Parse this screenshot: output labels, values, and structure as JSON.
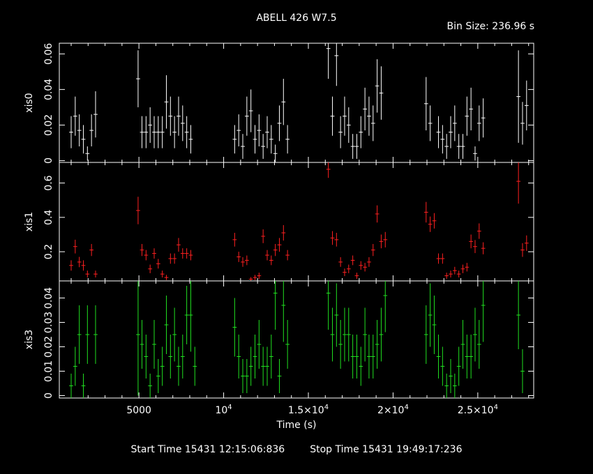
{
  "chart_data": {
    "type": "scatter",
    "title": "ABELL 426 W7.5",
    "bin_size_label": "Bin Size: 236.96 s",
    "xlabel": "Time (s)",
    "xlim": [
      300,
      28300
    ],
    "x_ticks": [
      {
        "value": 5000,
        "label": "5000"
      },
      {
        "value": 10000,
        "label": "10",
        "exp": "4"
      },
      {
        "value": 15000,
        "label": "1.5×10",
        "exp": "4"
      },
      {
        "value": 20000,
        "label": "2×10",
        "exp": "4"
      },
      {
        "value": 25000,
        "label": "2.5×10",
        "exp": "4"
      }
    ],
    "footer": {
      "start": "Start Time 15431 12:15:06:836",
      "stop": "Stop Time 15431 19:49:17:236"
    },
    "xerr": 118.5,
    "panels": [
      {
        "name": "xis0",
        "ylabel": "xis0",
        "color": "#ffffff",
        "ylim": [
          -0.001,
          0.066
        ],
        "y_ticks": [
          0,
          0.02,
          0.04,
          0.06
        ],
        "y_tick_labels": [
          "0",
          "0.02",
          "0.04",
          "0.06"
        ],
        "points": [
          [
            1000,
            0.016,
            0.009
          ],
          [
            1240,
            0.025,
            0.011
          ],
          [
            1480,
            0.017,
            0.009
          ],
          [
            1720,
            0.012,
            0.008
          ],
          [
            1960,
            0.004,
            0.004
          ],
          [
            2200,
            0.017,
            0.009
          ],
          [
            2440,
            0.026,
            0.013
          ],
          [
            4950,
            0.046,
            0.016
          ],
          [
            5180,
            0.016,
            0.009
          ],
          [
            5420,
            0.016,
            0.009
          ],
          [
            5660,
            0.02,
            0.01
          ],
          [
            5900,
            0.016,
            0.009
          ],
          [
            6140,
            0.016,
            0.009
          ],
          [
            6380,
            0.016,
            0.009
          ],
          [
            6620,
            0.033,
            0.015
          ],
          [
            6860,
            0.025,
            0.011
          ],
          [
            7100,
            0.016,
            0.009
          ],
          [
            7340,
            0.025,
            0.011
          ],
          [
            7580,
            0.021,
            0.01
          ],
          [
            7820,
            0.016,
            0.009
          ],
          [
            8060,
            0.012,
            0.008
          ],
          [
            10650,
            0.012,
            0.008
          ],
          [
            10890,
            0.017,
            0.009
          ],
          [
            11130,
            0.008,
            0.007
          ],
          [
            11370,
            0.025,
            0.011
          ],
          [
            11610,
            0.028,
            0.012
          ],
          [
            11850,
            0.012,
            0.008
          ],
          [
            12090,
            0.017,
            0.009
          ],
          [
            12330,
            0.008,
            0.007
          ],
          [
            12570,
            0.016,
            0.009
          ],
          [
            12810,
            0.012,
            0.008
          ],
          [
            13050,
            0.004,
            0.005
          ],
          [
            13290,
            0.021,
            0.01
          ],
          [
            13530,
            0.033,
            0.013
          ],
          [
            13770,
            0.012,
            0.008
          ],
          [
            16180,
            0.063,
            0.017
          ],
          [
            16420,
            0.025,
            0.011
          ],
          [
            16660,
            0.059,
            0.017
          ],
          [
            16900,
            0.016,
            0.009
          ],
          [
            17140,
            0.025,
            0.011
          ],
          [
            17380,
            0.02,
            0.01
          ],
          [
            17620,
            0.008,
            0.007
          ],
          [
            17860,
            0.008,
            0.007
          ],
          [
            18100,
            0.016,
            0.009
          ],
          [
            18340,
            0.029,
            0.012
          ],
          [
            18580,
            0.025,
            0.011
          ],
          [
            18820,
            0.021,
            0.01
          ],
          [
            19060,
            0.042,
            0.015
          ],
          [
            19300,
            0.038,
            0.015
          ],
          [
            21950,
            0.032,
            0.015
          ],
          [
            22190,
            0.021,
            0.01
          ],
          [
            22680,
            0.016,
            0.009
          ],
          [
            22920,
            0.012,
            0.008
          ],
          [
            23160,
            0.008,
            0.007
          ],
          [
            23400,
            0.016,
            0.009
          ],
          [
            23640,
            0.021,
            0.01
          ],
          [
            23880,
            0.008,
            0.007
          ],
          [
            24120,
            0.008,
            0.007
          ],
          [
            24360,
            0.025,
            0.011
          ],
          [
            24600,
            0.029,
            0.012
          ],
          [
            24840,
            0.004,
            0.004
          ],
          [
            25080,
            0.021,
            0.01
          ],
          [
            25320,
            0.024,
            0.011
          ],
          [
            27400,
            0.036,
            0.026
          ],
          [
            27640,
            0.021,
            0.012
          ],
          [
            27880,
            0.031,
            0.014
          ]
        ]
      },
      {
        "name": "xis1",
        "ylabel": "xis1",
        "color": "#ff2020",
        "ylim": [
          0.03,
          0.72
        ],
        "y_ticks": [
          0.2,
          0.4,
          0.6
        ],
        "y_tick_labels": [
          "0.2",
          "0.4",
          "0.6"
        ],
        "points": [
          [
            1000,
            0.12,
            0.03
          ],
          [
            1240,
            0.23,
            0.04
          ],
          [
            1480,
            0.14,
            0.03
          ],
          [
            1720,
            0.12,
            0.03
          ],
          [
            1960,
            0.07,
            0.02
          ],
          [
            2200,
            0.21,
            0.035
          ],
          [
            2440,
            0.07,
            0.02
          ],
          [
            4950,
            0.44,
            0.08
          ],
          [
            5180,
            0.21,
            0.035
          ],
          [
            5420,
            0.18,
            0.03
          ],
          [
            5660,
            0.1,
            0.025
          ],
          [
            5900,
            0.19,
            0.03
          ],
          [
            6140,
            0.13,
            0.028
          ],
          [
            6380,
            0.07,
            0.02
          ],
          [
            6620,
            0.05,
            0.015
          ],
          [
            6860,
            0.16,
            0.03
          ],
          [
            7100,
            0.16,
            0.03
          ],
          [
            7340,
            0.24,
            0.04
          ],
          [
            7580,
            0.19,
            0.03
          ],
          [
            7820,
            0.19,
            0.03
          ],
          [
            8060,
            0.18,
            0.03
          ],
          [
            10650,
            0.27,
            0.04
          ],
          [
            10890,
            0.17,
            0.03
          ],
          [
            11130,
            0.14,
            0.028
          ],
          [
            11370,
            0.15,
            0.028
          ],
          [
            11610,
            0.04,
            0.012
          ],
          [
            11850,
            0.05,
            0.015
          ],
          [
            12090,
            0.06,
            0.018
          ],
          [
            12330,
            0.29,
            0.04
          ],
          [
            12570,
            0.18,
            0.03
          ],
          [
            12810,
            0.15,
            0.028
          ],
          [
            13050,
            0.21,
            0.035
          ],
          [
            13290,
            0.24,
            0.04
          ],
          [
            13530,
            0.31,
            0.045
          ],
          [
            13770,
            0.18,
            0.03
          ],
          [
            16180,
            0.68,
            0.05
          ],
          [
            16420,
            0.28,
            0.04
          ],
          [
            16660,
            0.27,
            0.04
          ],
          [
            16900,
            0.14,
            0.028
          ],
          [
            17140,
            0.08,
            0.022
          ],
          [
            17380,
            0.1,
            0.025
          ],
          [
            17620,
            0.15,
            0.028
          ],
          [
            17860,
            0.06,
            0.018
          ],
          [
            18100,
            0.12,
            0.025
          ],
          [
            18340,
            0.11,
            0.025
          ],
          [
            18580,
            0.14,
            0.028
          ],
          [
            18820,
            0.21,
            0.035
          ],
          [
            19060,
            0.42,
            0.05
          ],
          [
            19300,
            0.26,
            0.04
          ],
          [
            19540,
            0.27,
            0.045
          ],
          [
            21950,
            0.43,
            0.06
          ],
          [
            22190,
            0.36,
            0.045
          ],
          [
            22430,
            0.38,
            0.045
          ],
          [
            22680,
            0.16,
            0.03
          ],
          [
            22920,
            0.16,
            0.03
          ],
          [
            23160,
            0.06,
            0.018
          ],
          [
            23400,
            0.07,
            0.02
          ],
          [
            23640,
            0.09,
            0.022
          ],
          [
            23880,
            0.07,
            0.02
          ],
          [
            24120,
            0.1,
            0.025
          ],
          [
            24360,
            0.11,
            0.025
          ],
          [
            24600,
            0.26,
            0.04
          ],
          [
            24840,
            0.23,
            0.038
          ],
          [
            25080,
            0.32,
            0.045
          ],
          [
            25320,
            0.22,
            0.035
          ],
          [
            27400,
            0.61,
            0.13
          ],
          [
            27640,
            0.21,
            0.04
          ],
          [
            27880,
            0.25,
            0.045
          ]
        ]
      },
      {
        "name": "xis3",
        "ylabel": "xis3",
        "color": "#20e020",
        "ylim": [
          -0.001,
          0.047
        ],
        "y_ticks": [
          0,
          0.01,
          0.02,
          0.03,
          0.04
        ],
        "y_tick_labels": [
          "0",
          "0.01",
          "0.02",
          "0.03",
          "0.04"
        ],
        "points": [
          [
            1000,
            0.004,
            0.005
          ],
          [
            1240,
            0.012,
            0.008
          ],
          [
            1480,
            0.025,
            0.012
          ],
          [
            1720,
            0.004,
            0.005
          ],
          [
            1960,
            0.025,
            0.012
          ],
          [
            2440,
            0.025,
            0.012
          ],
          [
            4950,
            0.025,
            0.025
          ],
          [
            5180,
            0.021,
            0.01
          ],
          [
            5420,
            0.016,
            0.009
          ],
          [
            5660,
            0.004,
            0.005
          ],
          [
            5900,
            0.021,
            0.01
          ],
          [
            6140,
            0.008,
            0.007
          ],
          [
            6380,
            0.012,
            0.008
          ],
          [
            6620,
            0.029,
            0.012
          ],
          [
            6860,
            0.016,
            0.009
          ],
          [
            7100,
            0.025,
            0.011
          ],
          [
            7340,
            0.012,
            0.008
          ],
          [
            7580,
            0.016,
            0.009
          ],
          [
            7820,
            0.033,
            0.012
          ],
          [
            8060,
            0.033,
            0.015
          ],
          [
            8300,
            0.012,
            0.008
          ],
          [
            10650,
            0.028,
            0.012
          ],
          [
            10890,
            0.016,
            0.009
          ],
          [
            11130,
            0.008,
            0.007
          ],
          [
            11370,
            0.008,
            0.007
          ],
          [
            11610,
            0.012,
            0.008
          ],
          [
            11850,
            0.016,
            0.009
          ],
          [
            12090,
            0.021,
            0.01
          ],
          [
            12330,
            0.012,
            0.008
          ],
          [
            12570,
            0.012,
            0.008
          ],
          [
            12810,
            0.016,
            0.009
          ],
          [
            13050,
            0.042,
            0.015
          ],
          [
            13290,
            0.008,
            0.007
          ],
          [
            13530,
            0.037,
            0.015
          ],
          [
            13770,
            0.021,
            0.01
          ],
          [
            16180,
            0.042,
            0.015
          ],
          [
            16420,
            0.025,
            0.011
          ],
          [
            16660,
            0.033,
            0.013
          ],
          [
            16900,
            0.021,
            0.01
          ],
          [
            17140,
            0.025,
            0.011
          ],
          [
            17380,
            0.025,
            0.011
          ],
          [
            17620,
            0.016,
            0.009
          ],
          [
            17860,
            0.016,
            0.009
          ],
          [
            18100,
            0.012,
            0.008
          ],
          [
            18340,
            0.025,
            0.011
          ],
          [
            18580,
            0.016,
            0.009
          ],
          [
            18820,
            0.016,
            0.009
          ],
          [
            19060,
            0.021,
            0.01
          ],
          [
            19300,
            0.025,
            0.011
          ],
          [
            19540,
            0.041,
            0.015
          ],
          [
            21950,
            0.025,
            0.012
          ],
          [
            22190,
            0.033,
            0.013
          ],
          [
            22430,
            0.029,
            0.012
          ],
          [
            22680,
            0.016,
            0.009
          ],
          [
            22920,
            0.012,
            0.008
          ],
          [
            23160,
            0.004,
            0.005
          ],
          [
            23400,
            0.008,
            0.007
          ],
          [
            23640,
            0.004,
            0.005
          ],
          [
            23880,
            0.012,
            0.008
          ],
          [
            24120,
            0.021,
            0.01
          ],
          [
            24360,
            0.016,
            0.009
          ],
          [
            24600,
            0.016,
            0.009
          ],
          [
            24840,
            0.025,
            0.011
          ],
          [
            25080,
            0.021,
            0.01
          ],
          [
            25320,
            0.037,
            0.015
          ],
          [
            27400,
            0.033,
            0.014
          ],
          [
            27640,
            0.01,
            0.009
          ]
        ]
      }
    ]
  }
}
